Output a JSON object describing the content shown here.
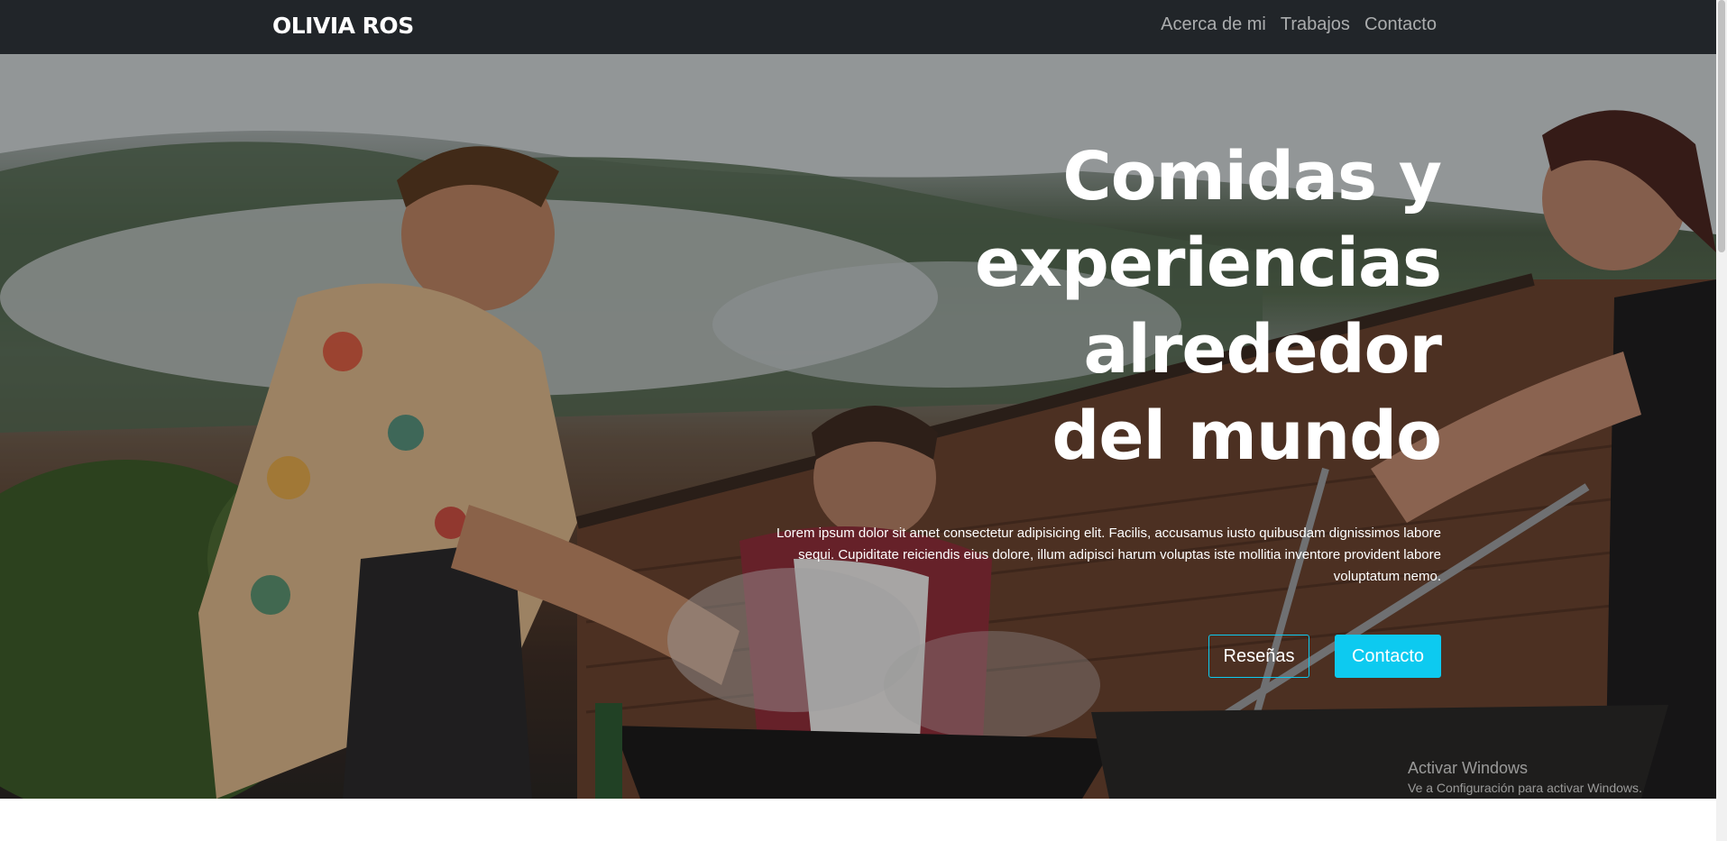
{
  "navbar": {
    "brand": "OLIVIA ROS",
    "links": [
      "Acerca de mi",
      "Trabajos",
      "Contacto"
    ]
  },
  "hero": {
    "title_lines": [
      "Comidas y",
      "experiencias",
      "alrededor",
      "del mundo"
    ],
    "text": "Lorem ipsum dolor sit amet consectetur adipisicing elit. Facilis, accusamus iusto quibusdam dignissimos labore sequi. Cupiditate reiciendis eius dolore, illum adipisci harum voluptas iste mollitia inventore provident labore voluptatum nemo.",
    "buttons": {
      "reviews": "Reseñas",
      "contact": "Contacto"
    }
  },
  "watermark": {
    "title": "Activar Windows",
    "subtitle": "Ve a Configuración para activar Windows."
  },
  "colors": {
    "navbar_bg": "#212529",
    "accent": "#0dcaf0",
    "nav_link": "rgba(255,255,255,0.62)"
  }
}
